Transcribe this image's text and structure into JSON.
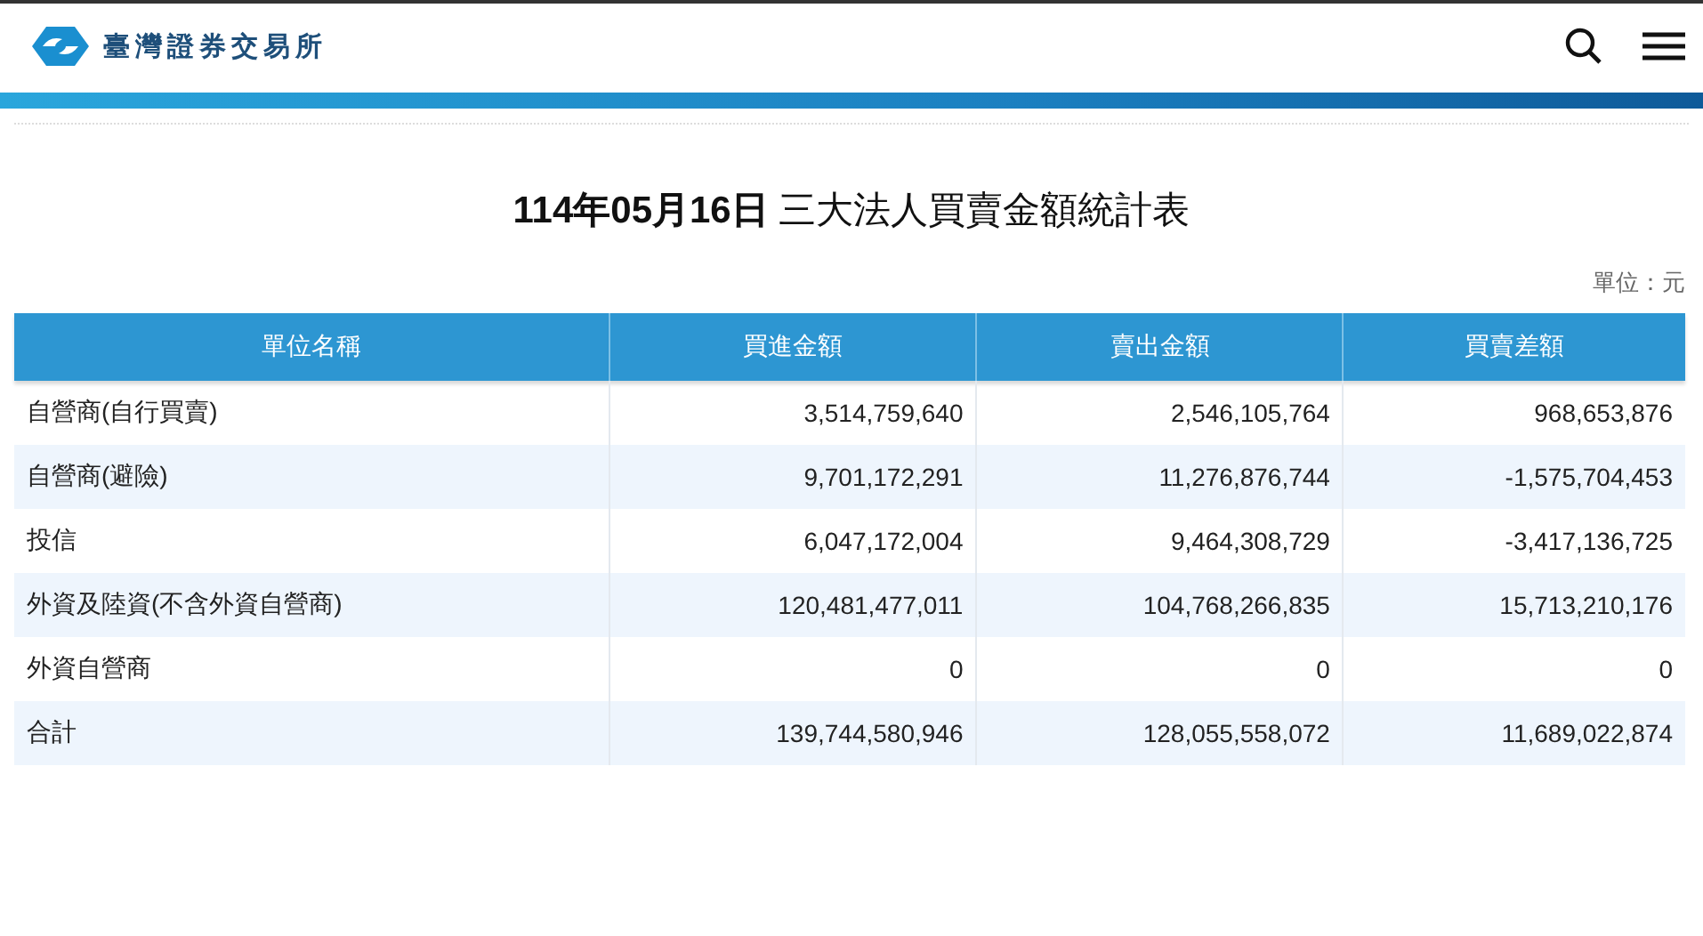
{
  "header": {
    "site_name": "臺灣證券交易所"
  },
  "report": {
    "title": "**114年05月16日** 三大法人買賣金額統計表",
    "unit": "單位：元"
  },
  "table": {
    "columns": [
      "單位名稱",
      "買進金額",
      "賣出金額",
      "買賣差額"
    ],
    "rows": [
      [
        "自營商(自行買賣)",
        "3,514,759,640",
        "2,546,105,764",
        "968,653,876"
      ],
      [
        "自營商(避險)",
        "9,701,172,291",
        "11,276,876,744",
        "-1,575,704,453"
      ],
      [
        "投信",
        "6,047,172,004",
        "9,464,308,729",
        "-3,417,136,725"
      ],
      [
        "外資及陸資(不含外資自營商)",
        "120,481,477,011",
        "104,768,266,835",
        "15,713,210,176"
      ],
      [
        "外資自營商",
        "0",
        "0",
        "0"
      ],
      [
        "合計",
        "139,744,580,946",
        "128,055,558,072",
        "11,689,022,874"
      ]
    ]
  }
}
